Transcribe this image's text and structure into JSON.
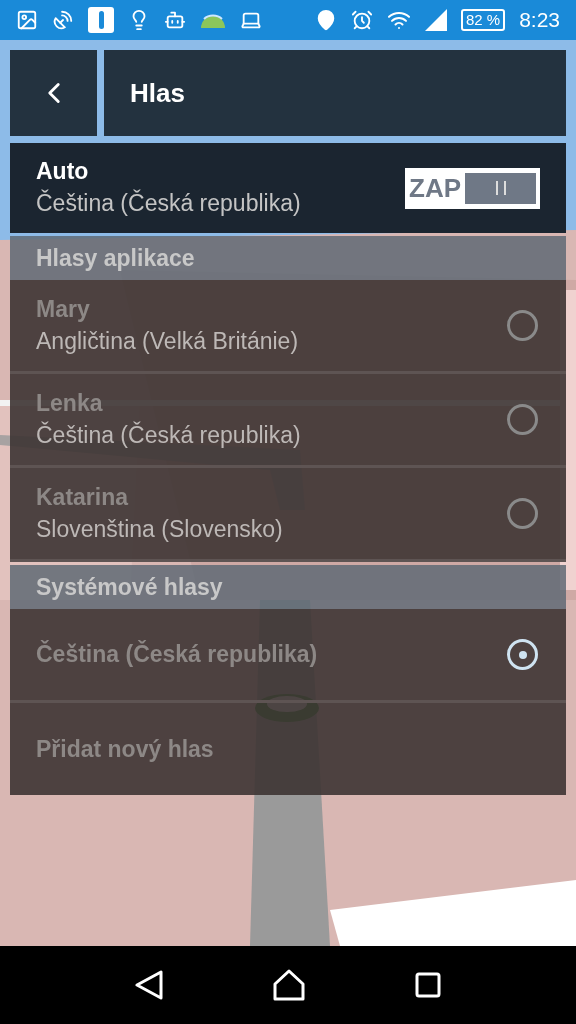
{
  "status_bar": {
    "battery": "82 %",
    "time": "8:23"
  },
  "header": {
    "title": "Hlas"
  },
  "auto": {
    "title": "Auto",
    "subtitle": "Čeština (Česká republika)",
    "toggle": {
      "label": "ZAP",
      "on": true
    }
  },
  "sections": [
    {
      "title": "Hlasy aplikace",
      "items": [
        {
          "kind": "voice",
          "name": "Mary",
          "language": "Angličtina (Velká Británie)",
          "selected": false
        },
        {
          "kind": "voice",
          "name": "Lenka",
          "language": "Čeština (Česká republika)",
          "selected": false
        },
        {
          "kind": "voice",
          "name": "Katarina",
          "language": "Slovenština (Slovensko)",
          "selected": false
        }
      ]
    },
    {
      "title": "Systémové hlasy",
      "items": [
        {
          "kind": "system",
          "language": "Čeština (Česká republika)",
          "selected": true
        },
        {
          "kind": "action",
          "label": "Přidat nový hlas"
        }
      ]
    }
  ]
}
